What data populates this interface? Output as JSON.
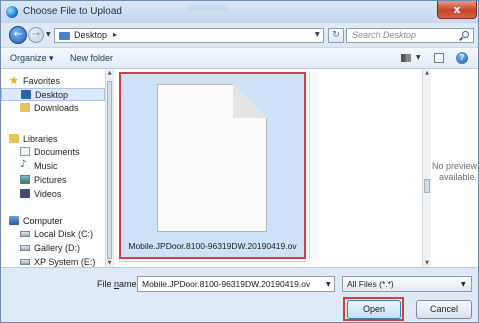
{
  "window": {
    "title": "Choose File to Upload",
    "close_glyph": "x"
  },
  "address": {
    "location": "Desktop",
    "separator": "▸",
    "search_placeholder": "Search Desktop"
  },
  "toolbar": {
    "organize": "Organize ▾",
    "new_folder": "New folder"
  },
  "sidebar": {
    "favorites": {
      "header": "Favorites",
      "items": [
        "Desktop",
        "Downloads"
      ]
    },
    "libraries": {
      "header": "Libraries",
      "items": [
        "Documents",
        "Music",
        "Pictures",
        "Videos"
      ]
    },
    "computer": {
      "header": "Computer",
      "items": [
        "Local Disk (C:)",
        "Gallery (D:)",
        "XP System (E:)"
      ]
    },
    "selected": "Desktop"
  },
  "content": {
    "file_name": "Mobile.JPDoor.8100-96319DW.20190419.ov"
  },
  "preview": {
    "line1": "No preview",
    "line2": "available."
  },
  "bottom": {
    "file_name_label_pre": "File ",
    "file_name_label_u": "n",
    "file_name_label_post": "ame:",
    "file_name_value": "Mobile.JPDoor.8100-96319DW.20190419.ov",
    "filter_value": "All Files (*.*)",
    "open_label": "Open",
    "cancel_label": "Cancel"
  },
  "colors": {
    "accent": "#1f5fb0",
    "selection": "#cfe1f6",
    "highlight_outline": "#d04040"
  },
  "icons": {
    "app": "ie-icon",
    "back": "back-arrow-icon",
    "forward": "forward-arrow-icon",
    "refresh": "refresh-icon",
    "search": "search-icon",
    "views": "views-icon",
    "preview": "preview-pane-icon",
    "help": "help-icon"
  }
}
